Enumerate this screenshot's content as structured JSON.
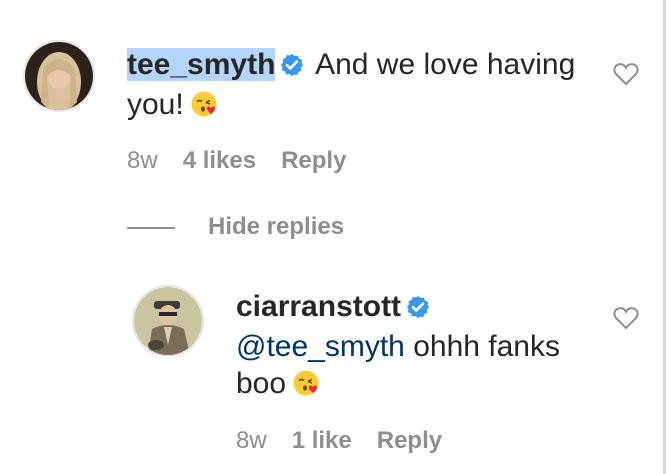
{
  "comment": {
    "username": "tee_smyth",
    "text": "And we love having you!",
    "meta": {
      "time": "8w",
      "likes": "4 likes",
      "reply": "Reply"
    }
  },
  "toggle_replies": {
    "label": "Hide replies"
  },
  "reply": {
    "username": "ciarranstott",
    "mention": "@tee_smyth",
    "text": "ohhh fanks boo",
    "meta": {
      "time": "8w",
      "likes": "1 like",
      "reply": "Reply"
    }
  },
  "colors": {
    "verified_badge": "#3897f0",
    "mention": "#003569",
    "muted": "#8e8e8e",
    "selection_highlight": "#b4d5fe"
  },
  "icons": [
    "verified-badge-icon",
    "heart-outline-icon",
    "kissing-face-emoji"
  ]
}
